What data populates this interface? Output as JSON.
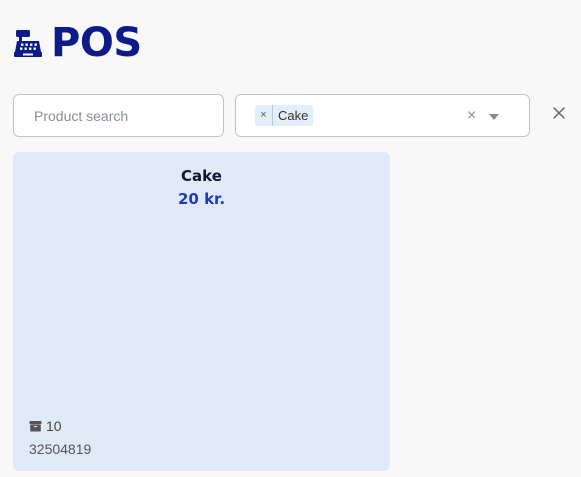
{
  "header": {
    "title": "POS",
    "icon": "cash-register-icon",
    "title_color": "#0d1a8a"
  },
  "search": {
    "placeholder": "Product search",
    "value": ""
  },
  "category_filter": {
    "selected": [
      {
        "label": "Cake",
        "remove_glyph": "×"
      }
    ],
    "clear_glyph": "×",
    "dropdown_icon": "caret-down-icon"
  },
  "reset_glyph_icon": "close-icon",
  "products": [
    {
      "name": "Cake",
      "price": "20 kr.",
      "stock": "10",
      "stock_icon": "box-icon",
      "barcode": "32504819",
      "background": "#dfeaf6",
      "price_color": "#1f3ac2"
    }
  ]
}
